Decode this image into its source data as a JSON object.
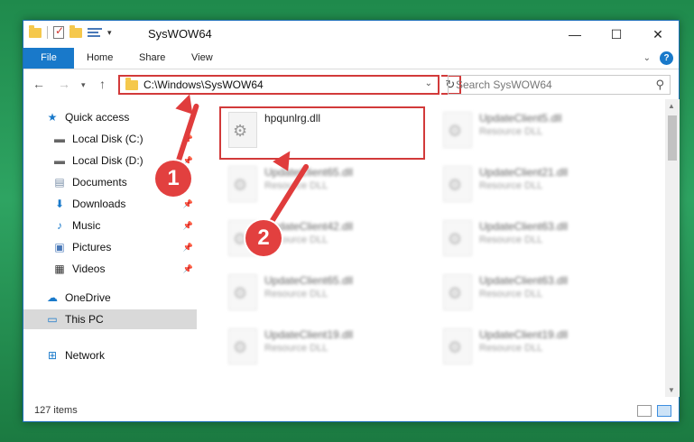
{
  "window": {
    "title": "SysWOW64",
    "controls": {
      "minimize": "—",
      "maximize": "☐",
      "close": "✕"
    }
  },
  "ribbon": {
    "tabs": [
      "File",
      "Home",
      "Share",
      "View"
    ],
    "help": "?"
  },
  "navigation": {
    "address": "C:\\Windows\\SysWOW64",
    "search_placeholder": "Search SysWOW64"
  },
  "sidebar": {
    "items": [
      {
        "label": "Quick access",
        "icon": "star-icon",
        "pinned": false
      },
      {
        "label": "Local Disk (C:)",
        "icon": "drive-icon",
        "pinned": true
      },
      {
        "label": "Local Disk (D:)",
        "icon": "drive-icon",
        "pinned": true
      },
      {
        "label": "Documents",
        "icon": "documents-icon",
        "pinned": true
      },
      {
        "label": "Downloads",
        "icon": "download-icon",
        "pinned": true
      },
      {
        "label": "Music",
        "icon": "music-icon",
        "pinned": true
      },
      {
        "label": "Pictures",
        "icon": "pictures-icon",
        "pinned": true
      },
      {
        "label": "Videos",
        "icon": "videos-icon",
        "pinned": true
      },
      {
        "label": "OneDrive",
        "icon": "cloud-icon",
        "pinned": false
      },
      {
        "label": "This PC",
        "icon": "computer-icon",
        "pinned": false,
        "selected": true
      },
      {
        "label": "Network",
        "icon": "network-icon",
        "pinned": false
      }
    ]
  },
  "files": {
    "highlighted": {
      "name": "hpqunlrg.dll",
      "type": ""
    },
    "background": [
      {
        "name": "UpdateClient5.dll",
        "type": "Resource DLL"
      },
      {
        "name": "UpdateClient65.dll",
        "type": "Resource DLL"
      },
      {
        "name": "UpdateClient21.dll",
        "type": "Resource DLL"
      },
      {
        "name": "UpdateClient42.dll",
        "type": "Resource DLL"
      },
      {
        "name": "UpdateClient63.dll",
        "type": "Resource DLL"
      },
      {
        "name": "UpdateClient65.dll",
        "type": "Resource DLL"
      },
      {
        "name": "UpdateClient63.dll",
        "type": "Resource DLL"
      },
      {
        "name": "UpdateClient19.dll",
        "type": "Resource DLL"
      },
      {
        "name": "UpdateClient19.dll",
        "type": "Resource DLL"
      }
    ]
  },
  "status": {
    "item_count": "127 items"
  },
  "annotations": {
    "step1": "1",
    "step2": "2",
    "color": "#e03c3c"
  }
}
